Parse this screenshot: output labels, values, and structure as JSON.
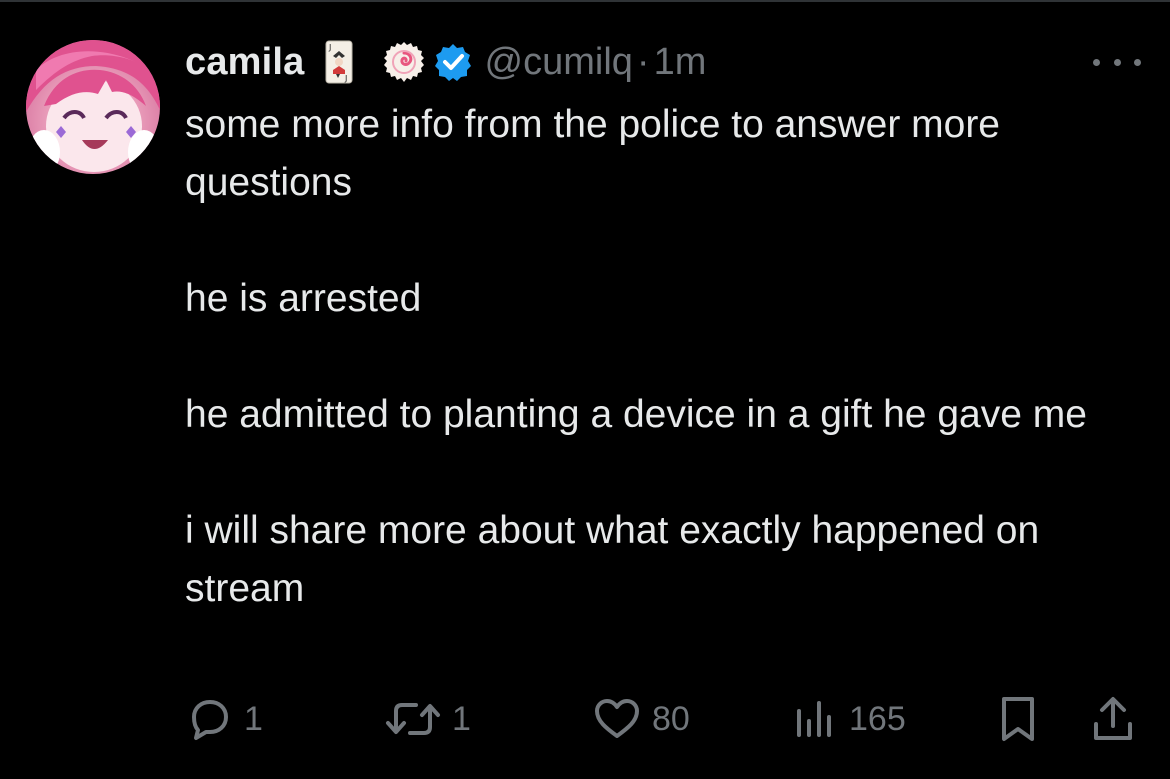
{
  "post": {
    "author": {
      "display_name": "camila",
      "handle": "@cumilq",
      "separator": "·",
      "timestamp": "1m",
      "verified_color": "#1d9bf0",
      "name_emojis": [
        "joker-card-icon",
        "narutomaki-icon"
      ],
      "avatar": "avatar"
    },
    "text_paragraphs": [
      "some more info from the police to answer more questions",
      "he is arrested",
      "he admitted to planting a device in a gift he gave me",
      "i will share more about what exactly happened on stream"
    ],
    "actions": {
      "reply_count": "1",
      "repost_count": "1",
      "like_count": "80",
      "view_count": "165"
    }
  },
  "colors": {
    "background": "#000000",
    "text_primary": "#e7e9ea",
    "text_secondary": "#71767b"
  }
}
